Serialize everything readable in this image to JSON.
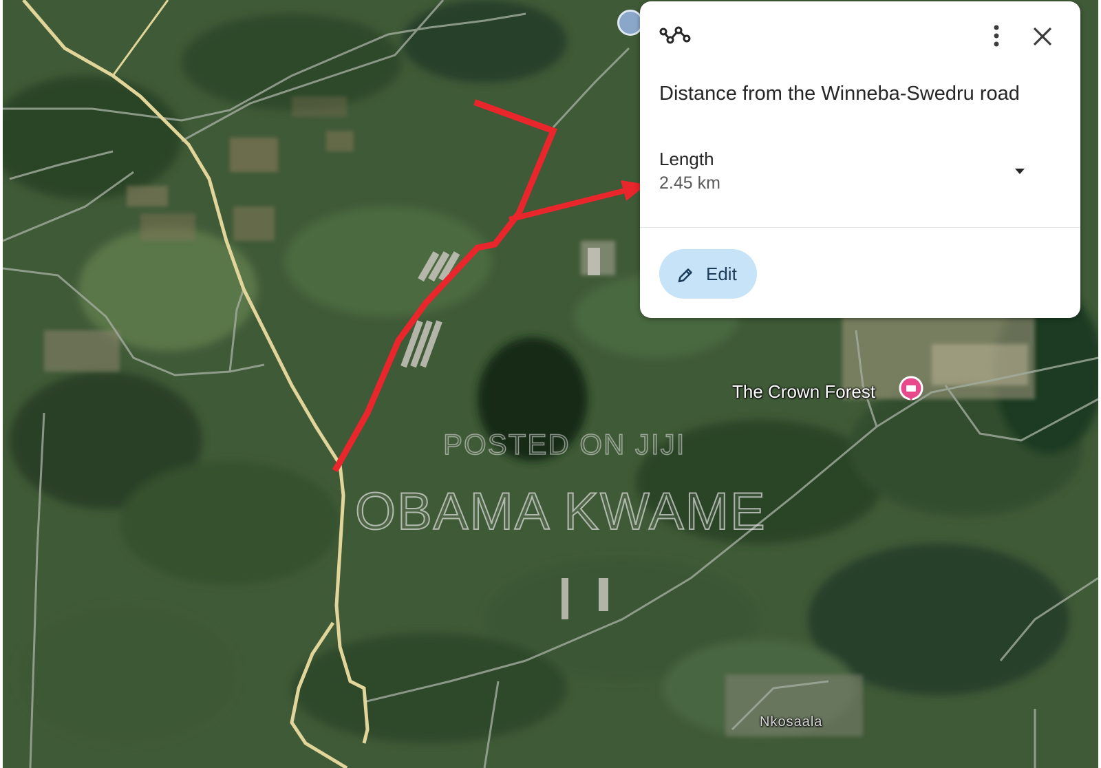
{
  "map": {
    "place_labels": {
      "crown_forest": "The Crown Forest",
      "lower_town": "Nkosaala"
    },
    "watermark": {
      "line1": "POSTED ON JIJI",
      "line2": "OBAMA KWAME"
    },
    "colors": {
      "measure_line": "#e8262b",
      "highway": "#e6d79a",
      "minor_road": "#a9b3a6",
      "poi_pin": "#e8498a"
    },
    "icons": {
      "poi": "poi-pin-icon",
      "location": "location-badge-icon"
    }
  },
  "panel": {
    "title": "Distance from the Winneba-Swedru road",
    "length_label": "Length",
    "length_value": "2.45 km",
    "edit_label": "Edit",
    "icons": {
      "path": "measure-path-icon",
      "more": "more-vert-icon",
      "close": "close-icon",
      "dropdown": "caret-down-icon",
      "edit": "pencil-icon"
    }
  }
}
